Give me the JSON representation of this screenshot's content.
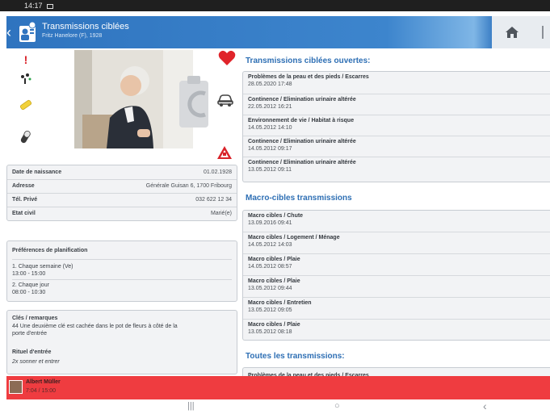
{
  "statusbar": {
    "time": "14:17"
  },
  "header": {
    "title": "Transmissions ciblées",
    "subtitle": "Fritz Hanelore (F), 1928"
  },
  "left_icons": {
    "alert": "!",
    "icons": [
      "exclamation-icon",
      "fork-icon",
      "pencil-icon",
      "pill-icon",
      "heart-icon",
      "camera-icon",
      "car-icon",
      "warning-icon"
    ]
  },
  "patient": {
    "fields": [
      {
        "label": "Date de naissance",
        "value": "01.02.1928"
      },
      {
        "label": "Adresse",
        "value": "Générale Guisan 6, 1700 Fribourg"
      },
      {
        "label": "Tél. Privé",
        "value": "032 622 12 34"
      },
      {
        "label": "Etat civil",
        "value": "Marié(e)"
      }
    ]
  },
  "planning": {
    "title": "Préférences de planification",
    "entries": [
      {
        "line1": "1. Chaque semaine (Ve)",
        "line2": "13:00 - 15:00"
      },
      {
        "line1": "2. Chaque jour",
        "line2": "08:00 - 10:30"
      }
    ]
  },
  "keys": {
    "title": "Clés / remarques",
    "text_line1": "44 Une deuxième clé est cachée dans le pot de fleurs à côté de la",
    "text_line2": "porte d'entrée",
    "ritual_title": "Rituel d'entrée",
    "ritual_text": "2x sonner et entrer"
  },
  "open_transmissions": {
    "title": "Transmissions ciblées ouvertes:",
    "items": [
      {
        "title": "Problèmes de la peau et des pieds / Escarres",
        "date": "28.05.2020 17:48"
      },
      {
        "title": "Continence / Elimination urinaire altérée",
        "date": "22.05.2012 16:21"
      },
      {
        "title": "Environnement de vie / Habitat à risque",
        "date": "14.05.2012 14:10"
      },
      {
        "title": "Continence / Elimination urinaire altérée",
        "date": "14.05.2012 09:17"
      },
      {
        "title": "Continence / Elimination urinaire altérée",
        "date": "13.05.2012 09:11"
      }
    ]
  },
  "macro": {
    "title": "Macro-cibles transmissions",
    "items": [
      {
        "title": "Macro cibles / Chute",
        "date": "13.09.2016 09:41"
      },
      {
        "title": "Macro cibles / Logement / Ménage",
        "date": "14.05.2012 14:03"
      },
      {
        "title": "Macro cibles / Plaie",
        "date": "14.05.2012 08:57"
      },
      {
        "title": "Macro cibles / Plaie",
        "date": "13.05.2012 09:44"
      },
      {
        "title": "Macro cibles / Entretien",
        "date": "13.05.2012 09:05"
      },
      {
        "title": "Macro cibles / Plaie",
        "date": "13.05.2012 08:18"
      }
    ]
  },
  "all_transmissions": {
    "title": "Toutes les transmissions:",
    "first_item": "Problèmes de la peau et des pieds / Escarres"
  },
  "footer": {
    "name": "Albert Müller",
    "sub": "7:04 / 15:00"
  },
  "navbar": {
    "recent": "|||",
    "home": "○",
    "back": "‹"
  },
  "colors": {
    "accent": "#2e6fb4",
    "header": "#2f74bf",
    "footer": "#ef3c40",
    "alert": "#d9232a"
  }
}
